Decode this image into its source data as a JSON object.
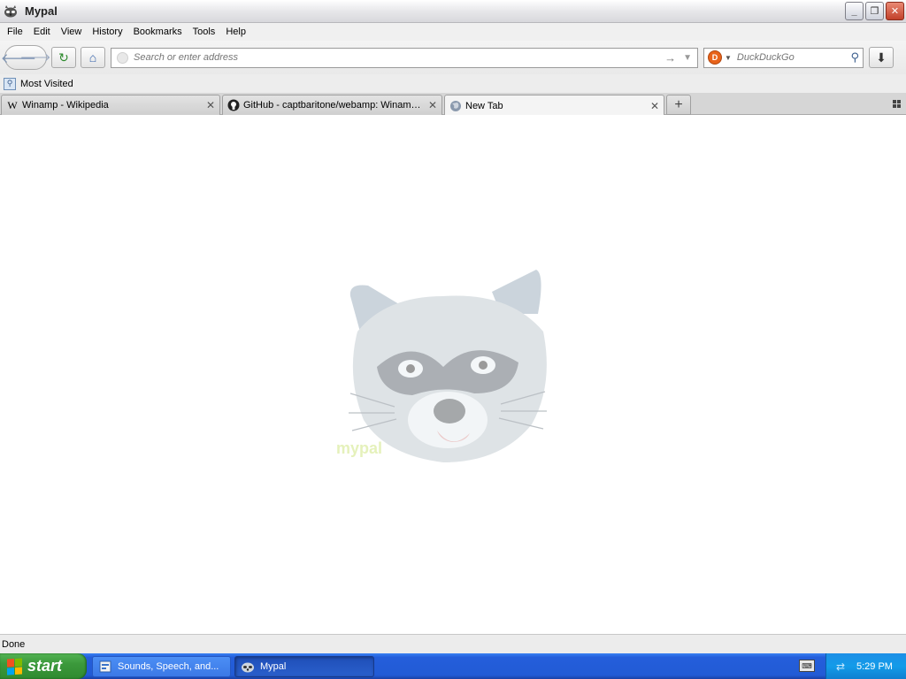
{
  "window": {
    "title": "Mypal",
    "app_icon": "raccoon-icon",
    "controls": [
      "minimize-icon",
      "restore-icon",
      "close-icon"
    ]
  },
  "menu": {
    "items": [
      {
        "label": "File"
      },
      {
        "label": "Edit"
      },
      {
        "label": "View"
      },
      {
        "label": "History"
      },
      {
        "label": "Bookmarks"
      },
      {
        "label": "Tools"
      },
      {
        "label": "Help"
      }
    ]
  },
  "toolbar": {
    "back_icon": "back-arrow-icon",
    "forward_icon": "forward-arrow-icon",
    "reload_icon": "reload-icon",
    "home_icon": "home-icon",
    "address": {
      "placeholder": "Search or enter address",
      "value": ""
    },
    "search": {
      "engine": "DuckDuckGo",
      "placeholder": "DuckDuckGo"
    },
    "downloads_icon": "download-icon"
  },
  "bookmarks_bar": {
    "items": [
      {
        "label": "Most Visited",
        "icon": "bookmarks-icon"
      }
    ]
  },
  "tabs": [
    {
      "label": "Winamp - Wikipedia",
      "icon": "wikipedia-icon",
      "selected": false
    },
    {
      "label": "GitHub - captbaritone/webamp: Winamp ...",
      "icon": "github-icon",
      "selected": false
    },
    {
      "label": "New Tab",
      "icon": "globe-icon",
      "selected": true
    }
  ],
  "content": {
    "logo_icon": "mypal-raccoon-logo"
  },
  "status": {
    "text": "Done"
  },
  "taskbar": {
    "start_label": "start",
    "tasks": [
      {
        "label": "Sounds, Speech, and...",
        "icon": "control-panel-icon",
        "active": false
      },
      {
        "label": "Mypal",
        "icon": "raccoon-icon",
        "active": true
      }
    ],
    "clock": "5:29 PM"
  },
  "colors": {
    "taskbar_blue": "#245edb",
    "start_green": "#3c993c",
    "tray_blue": "#139ce9",
    "close_red": "#c2402a"
  }
}
